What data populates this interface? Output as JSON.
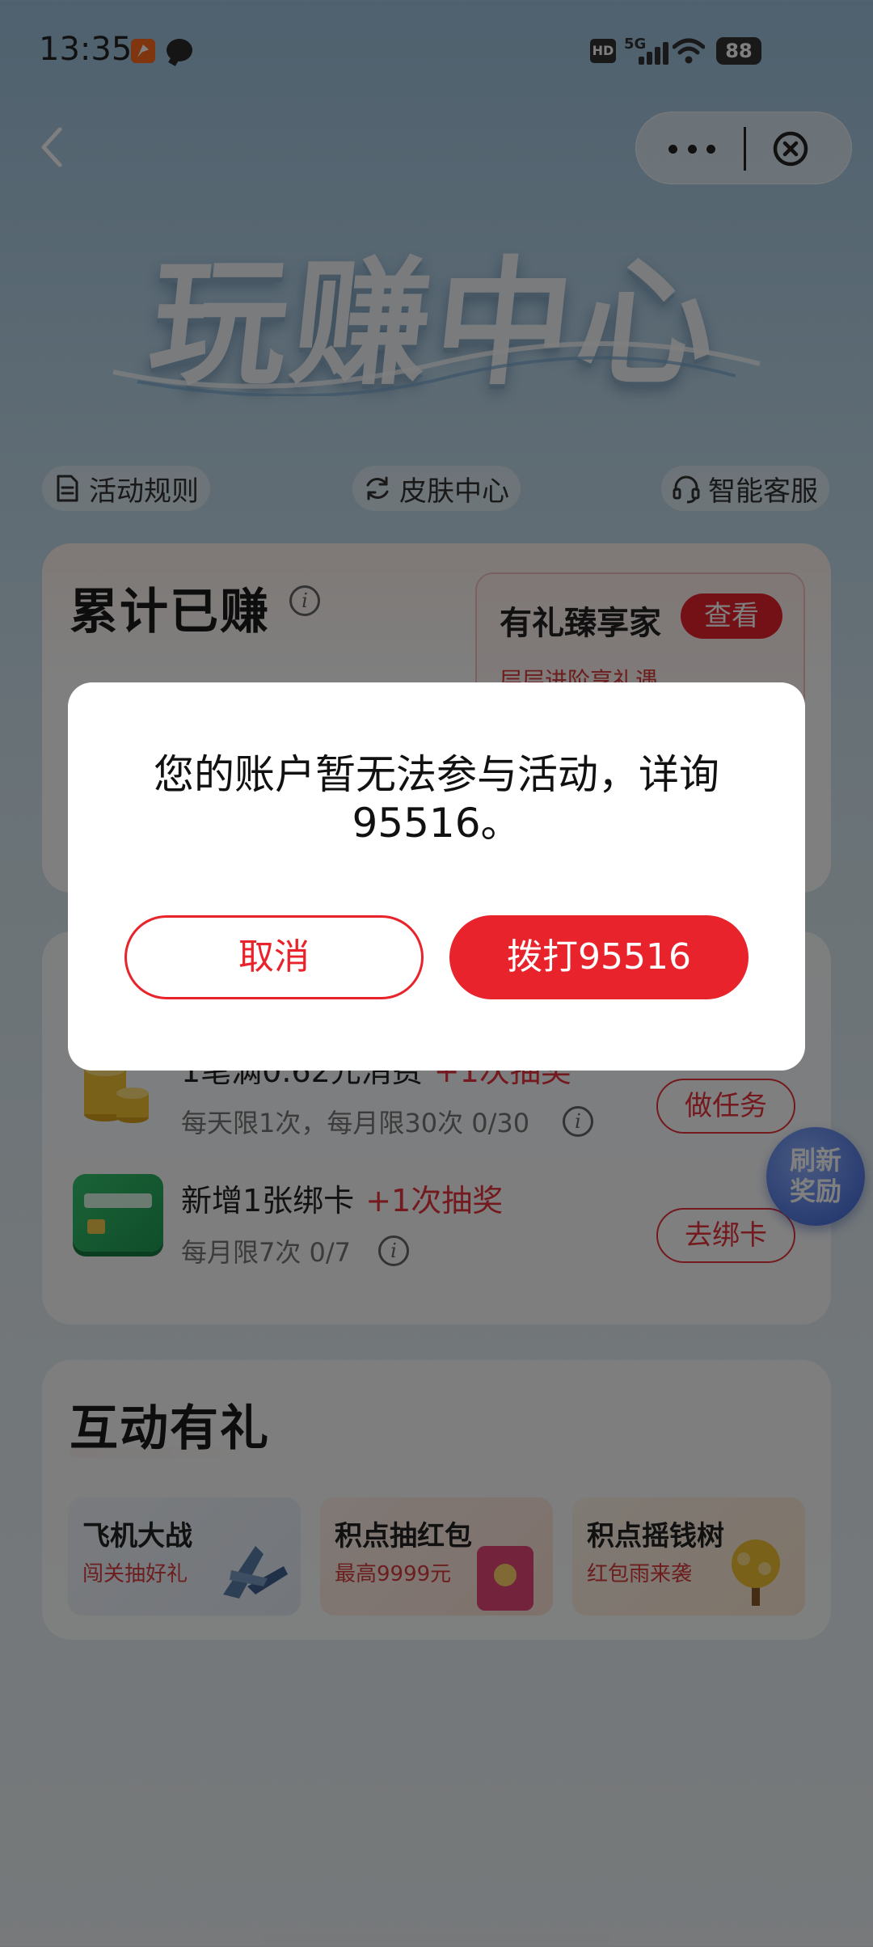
{
  "status_bar": {
    "time": "13:35",
    "hd_label": "HD",
    "network_label": "5G",
    "battery": "88"
  },
  "banner": {
    "title": "玩赚中心"
  },
  "quick_links": [
    {
      "label": "活动规则",
      "icon": "document-icon"
    },
    {
      "label": "皮肤中心",
      "icon": "refresh-icon"
    },
    {
      "label": "智能客服",
      "icon": "headset-icon"
    }
  ],
  "earnings": {
    "title": "累计已赚",
    "vip": {
      "title": "有礼臻享家",
      "button": "查看",
      "subtitle": "层层进阶享礼遇"
    }
  },
  "tasks": [
    {
      "name": "1笔满0.62元消费",
      "reward": "+1次抽奖",
      "sub": "每天限1次，每月限30次 0/30",
      "button": "做任务"
    },
    {
      "name": "新增1张绑卡",
      "reward": "+1次抽奖",
      "sub": "每月限7次 0/7",
      "button": "去绑卡"
    }
  ],
  "refresh_badge": {
    "line1": "刷新",
    "line2": "奖励"
  },
  "interactive": {
    "title": "互动有礼",
    "tiles": [
      {
        "name": "飞机大战",
        "sub": "闯关抽好礼"
      },
      {
        "name": "积点抽红包",
        "sub": "最高9999元"
      },
      {
        "name": "积点摇钱树",
        "sub": "红包雨来袭"
      }
    ]
  },
  "dialog": {
    "message": "您的账户暂无法参与活动，详询95516。",
    "cancel_label": "取消",
    "call_label": "拨打95516"
  },
  "colors": {
    "brand_red": "#e8232c",
    "overlay": "rgba(0,0,0,0.5)"
  }
}
